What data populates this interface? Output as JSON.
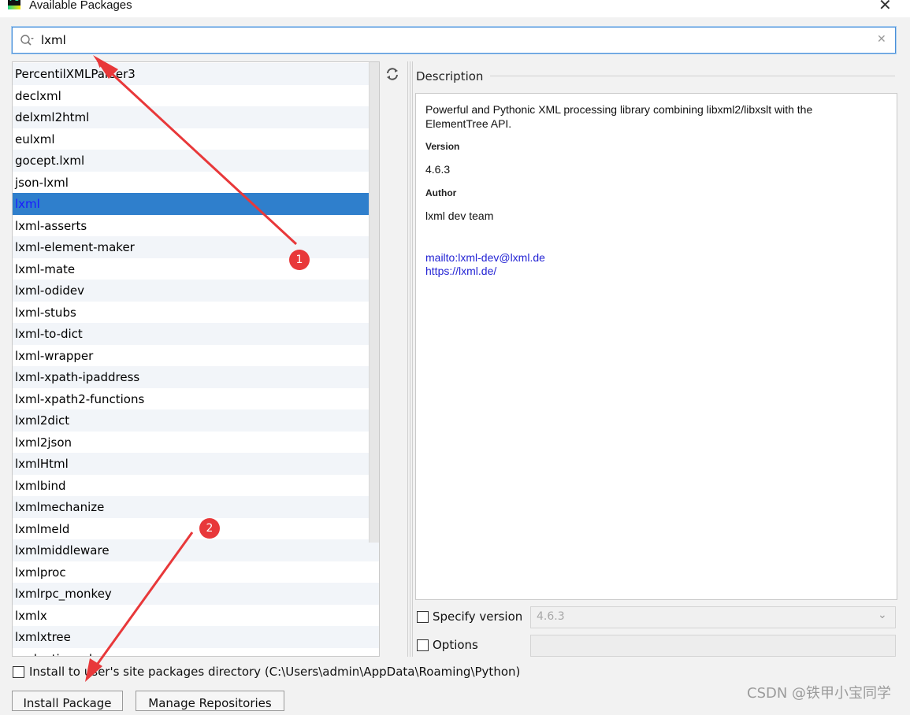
{
  "window": {
    "title": "Available Packages",
    "close_glyph": "✕",
    "app_icon_text": "PC"
  },
  "search": {
    "value": "lxml",
    "clear_glyph": "✕"
  },
  "packages": [
    "PercentilXMLParser3",
    "declxml",
    "delxml2html",
    "eulxml",
    "gocept.lxml",
    "json-lxml",
    "lxml",
    "lxml-asserts",
    "lxml-element-maker",
    "lxml-mate",
    "lxml-odidev",
    "lxml-stubs",
    "lxml-to-dict",
    "lxml-wrapper",
    "lxml-xpath-ipaddress",
    "lxml-xpath2-functions",
    "lxml2dict",
    "lxml2json",
    "lxmlHtml",
    "lxmlbind",
    "lxmlmechanize",
    "lxmlmeld",
    "lxmlmiddleware",
    "lxmlproc",
    "lxmlrpc_monkey",
    "lxmlx",
    "lxmlxtree",
    "pydantic-xml"
  ],
  "selected_index": 6,
  "description": {
    "label": "Description",
    "summary_line1": "Powerful and Pythonic XML processing library combining libxml2/libxslt with the",
    "summary_line2": "ElementTree API.",
    "version_heading": "Version",
    "version_value": "4.6.3",
    "author_heading": "Author",
    "author_value": "lxml dev team",
    "link_mail": "mailto:lxml-dev@lxml.de",
    "link_home": "https://lxml.de/"
  },
  "controls": {
    "specify_version_label": "Specify version",
    "specify_version_value": "4.6.3",
    "options_label": "Options",
    "install_user_label": "Install to user's site packages directory (C:\\Users\\admin\\AppData\\Roaming\\Python)",
    "install_button": "Install Package",
    "manage_button": "Manage Repositories"
  },
  "annotations": {
    "badge1": "1",
    "badge2": "2",
    "arrow_color": "#e8383a"
  },
  "watermark": "CSDN @铁甲小宝同学",
  "colors": {
    "selection": "#2f7fcc",
    "focus_border": "#4a90d9",
    "link": "#2424d4"
  }
}
